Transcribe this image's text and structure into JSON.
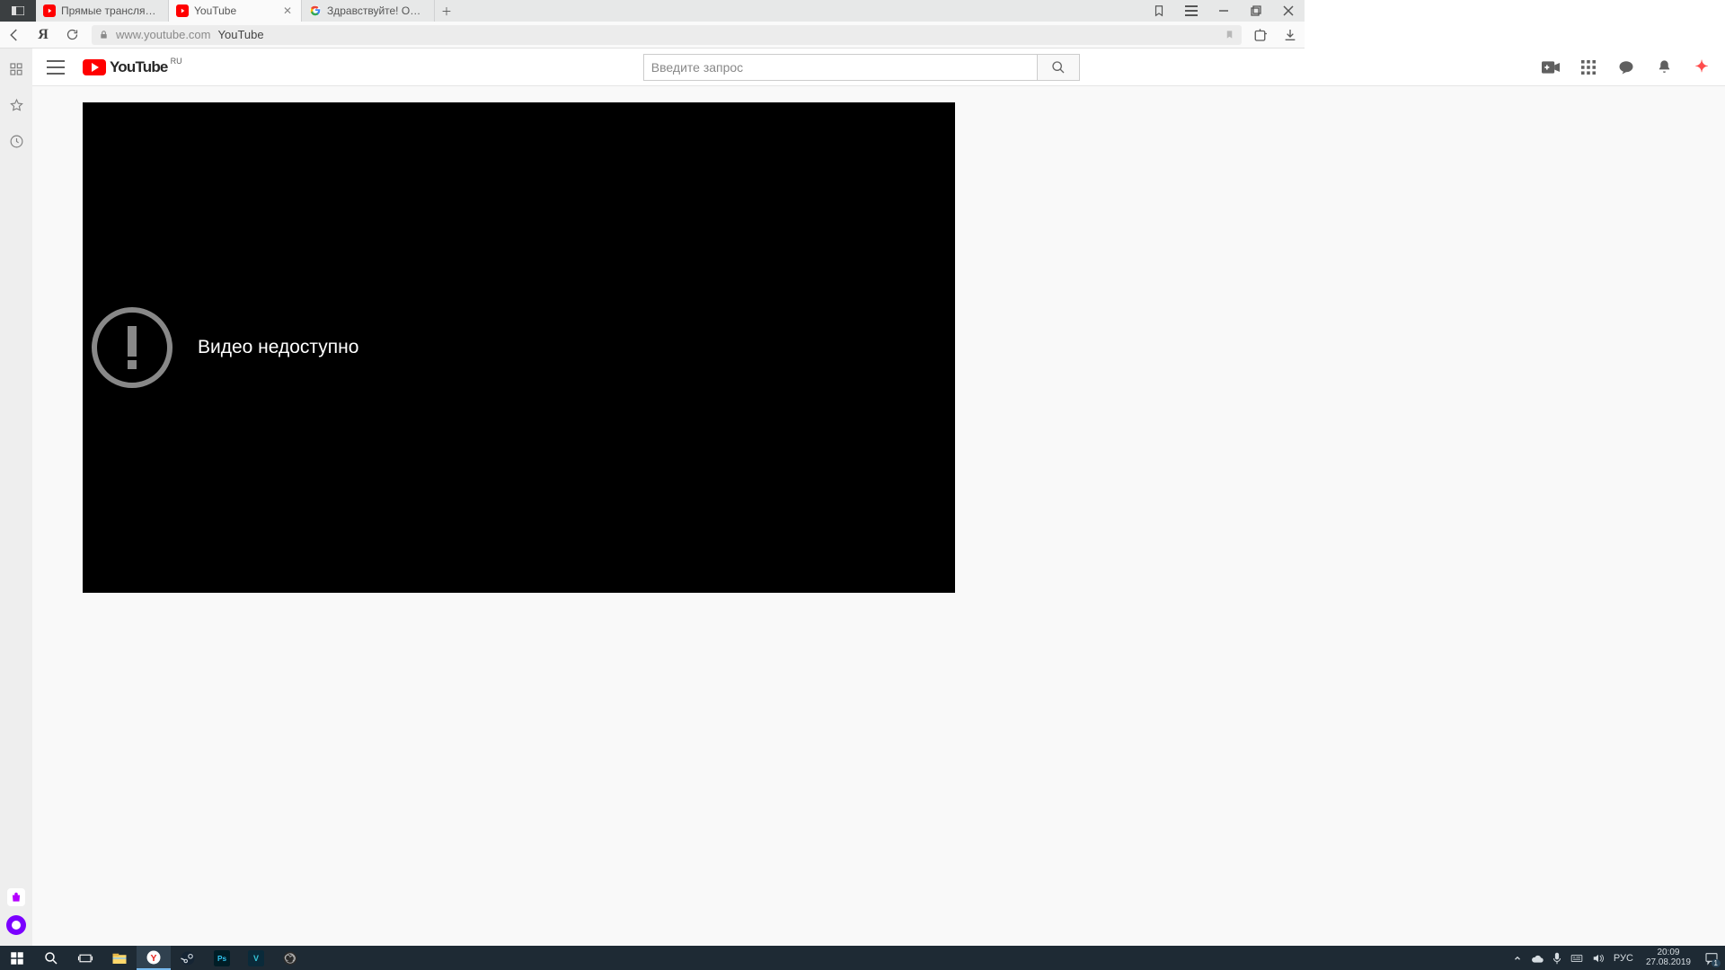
{
  "browser": {
    "tabs": [
      {
        "title": "Прямые трансляции - You",
        "icon": "youtube"
      },
      {
        "title": "YouTube",
        "icon": "youtube",
        "active": true
      },
      {
        "title": "Здравствуйте! Ошибка \"Ви",
        "icon": "google"
      }
    ],
    "address": {
      "host": "www.youtube.com",
      "title": "YouTube"
    }
  },
  "youtube": {
    "region": "RU",
    "brand": "YouTube",
    "search_placeholder": "Введите запрос",
    "error_text": "Видео недоступно"
  },
  "taskbar": {
    "lang": "РУС",
    "time": "20:09",
    "date": "27.08.2019",
    "notif_count": "1"
  }
}
